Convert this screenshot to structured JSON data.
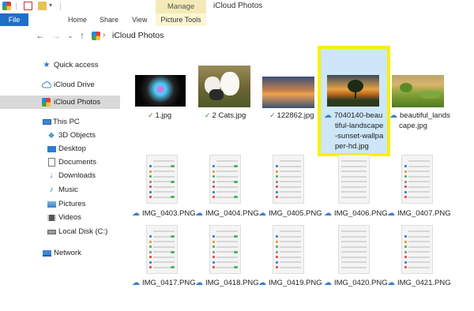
{
  "window": {
    "title": "iCloud Photos",
    "manage_tab": "Manage"
  },
  "ribbon": {
    "tabs": [
      "File",
      "Home",
      "Share",
      "View",
      "Picture Tools"
    ]
  },
  "address": {
    "location": "iCloud Photos"
  },
  "sidebar": {
    "items": [
      {
        "label": "Quick access",
        "icon": "star-icon"
      },
      {
        "label": "iCloud Drive",
        "icon": "cloud-icon"
      },
      {
        "label": "iCloud Photos",
        "icon": "photos-icon"
      },
      {
        "label": "This PC",
        "icon": "pc-icon"
      },
      {
        "label": "3D Objects",
        "icon": "cube-icon"
      },
      {
        "label": "Desktop",
        "icon": "desktop-icon"
      },
      {
        "label": "Documents",
        "icon": "documents-icon"
      },
      {
        "label": "Downloads",
        "icon": "download-icon"
      },
      {
        "label": "Music",
        "icon": "music-icon"
      },
      {
        "label": "Pictures",
        "icon": "pictures-icon"
      },
      {
        "label": "Videos",
        "icon": "videos-icon"
      },
      {
        "label": "Local Disk (C:)",
        "icon": "disk-icon"
      },
      {
        "label": "Network",
        "icon": "network-icon"
      }
    ]
  },
  "files": {
    "row1": [
      {
        "name": "1.jpg",
        "status": "synced"
      },
      {
        "name": "2 Cats.jpg",
        "status": "synced"
      },
      {
        "name": "122862.jpg",
        "status": "synced"
      },
      {
        "name_lines": [
          "7040140-beau",
          "tiful-landscape",
          "-sunset-wallpa",
          "per-hd.jpg"
        ],
        "status": "cloud"
      },
      {
        "name_lines": [
          "beautiful_lands",
          "cape.jpg"
        ],
        "status": "cloud"
      }
    ],
    "row2": [
      "IMG_0403.PNG",
      "IMG_0404.PNG",
      "IMG_0405.PNG",
      "IMG_0406.PNG",
      "IMG_0407.PNG"
    ],
    "row3": [
      "IMG_0417.PNG",
      "IMG_0418.PNG",
      "IMG_0419.PNG",
      "IMG_0420.PNG",
      "IMG_0421.PNG"
    ]
  }
}
